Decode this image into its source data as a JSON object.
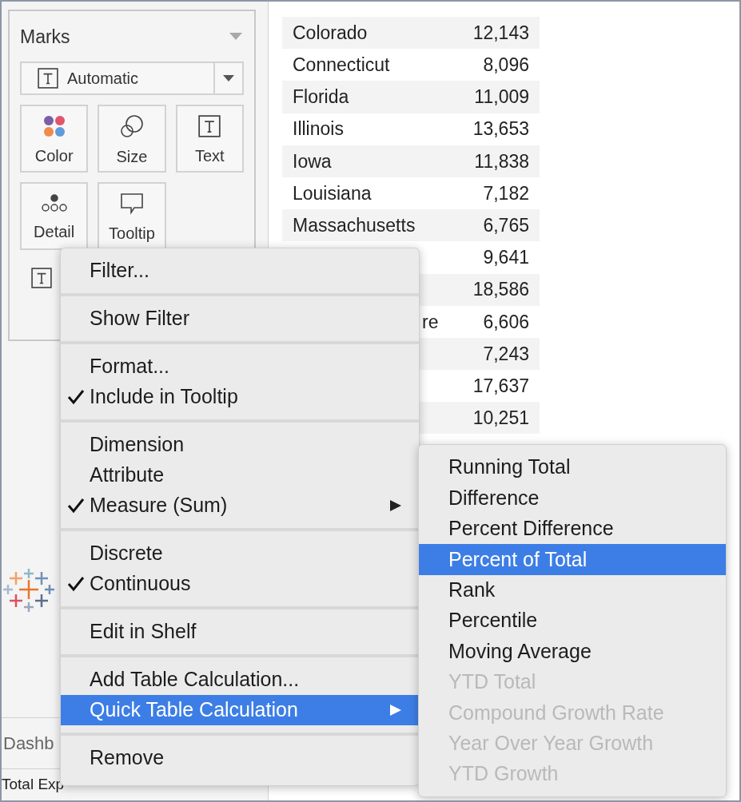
{
  "marks": {
    "title": "Marks",
    "mark_type": "Automatic",
    "cards": [
      {
        "label": "Color",
        "kind": "color"
      },
      {
        "label": "Size",
        "kind": "size"
      },
      {
        "label": "Text",
        "kind": "text"
      },
      {
        "label": "Detail",
        "kind": "detail"
      },
      {
        "label": "Tooltip",
        "kind": "tooltip"
      }
    ]
  },
  "table": {
    "rows": [
      {
        "name": "Colorado",
        "value": "12,143"
      },
      {
        "name": "Connecticut",
        "value": "8,096"
      },
      {
        "name": "Florida",
        "value": "11,009"
      },
      {
        "name": "Illinois",
        "value": "13,653"
      },
      {
        "name": "Iowa",
        "value": "11,838"
      },
      {
        "name": "Louisiana",
        "value": "7,182"
      },
      {
        "name": "Massachusetts",
        "value": "6,765"
      },
      {
        "value": "9,641"
      },
      {
        "value": "18,586"
      },
      {
        "name": "re",
        "value": "6,606"
      },
      {
        "value": "7,243"
      },
      {
        "value": "17,637"
      },
      {
        "value": "10,251"
      }
    ]
  },
  "sheet_tab": "Dashb",
  "status_bar": "Total Exp",
  "context_menu": {
    "groups": [
      [
        {
          "label": "Filter...",
          "checked": false,
          "submenu": false,
          "selected": false
        }
      ],
      [
        {
          "label": "Show Filter",
          "checked": false,
          "submenu": false,
          "selected": false
        }
      ],
      [
        {
          "label": "Format...",
          "checked": false,
          "submenu": false,
          "selected": false
        },
        {
          "label": "Include in Tooltip",
          "checked": true,
          "submenu": false,
          "selected": false
        }
      ],
      [
        {
          "label": "Dimension",
          "checked": false,
          "submenu": false,
          "selected": false
        },
        {
          "label": "Attribute",
          "checked": false,
          "submenu": false,
          "selected": false
        },
        {
          "label": "Measure (Sum)",
          "checked": true,
          "submenu": true,
          "selected": false
        }
      ],
      [
        {
          "label": "Discrete",
          "checked": false,
          "submenu": false,
          "selected": false
        },
        {
          "label": "Continuous",
          "checked": true,
          "submenu": false,
          "selected": false
        }
      ],
      [
        {
          "label": "Edit in Shelf",
          "checked": false,
          "submenu": false,
          "selected": false
        }
      ],
      [
        {
          "label": "Add Table Calculation...",
          "checked": false,
          "submenu": false,
          "selected": false
        },
        {
          "label": "Quick Table Calculation",
          "checked": false,
          "submenu": true,
          "selected": true
        }
      ],
      [
        {
          "label": "Remove",
          "checked": false,
          "submenu": false,
          "selected": false
        }
      ]
    ]
  },
  "submenu": {
    "items": [
      {
        "label": "Running Total",
        "selected": false,
        "disabled": false
      },
      {
        "label": "Difference",
        "selected": false,
        "disabled": false
      },
      {
        "label": "Percent Difference",
        "selected": false,
        "disabled": false
      },
      {
        "label": "Percent of Total",
        "selected": true,
        "disabled": false
      },
      {
        "label": "Rank",
        "selected": false,
        "disabled": false
      },
      {
        "label": "Percentile",
        "selected": false,
        "disabled": false
      },
      {
        "label": "Moving Average",
        "selected": false,
        "disabled": false
      },
      {
        "label": "YTD Total",
        "selected": false,
        "disabled": true
      },
      {
        "label": "Compound Growth Rate",
        "selected": false,
        "disabled": true
      },
      {
        "label": "Year Over Year Growth",
        "selected": false,
        "disabled": true
      },
      {
        "label": "YTD Growth",
        "selected": false,
        "disabled": true
      }
    ]
  }
}
